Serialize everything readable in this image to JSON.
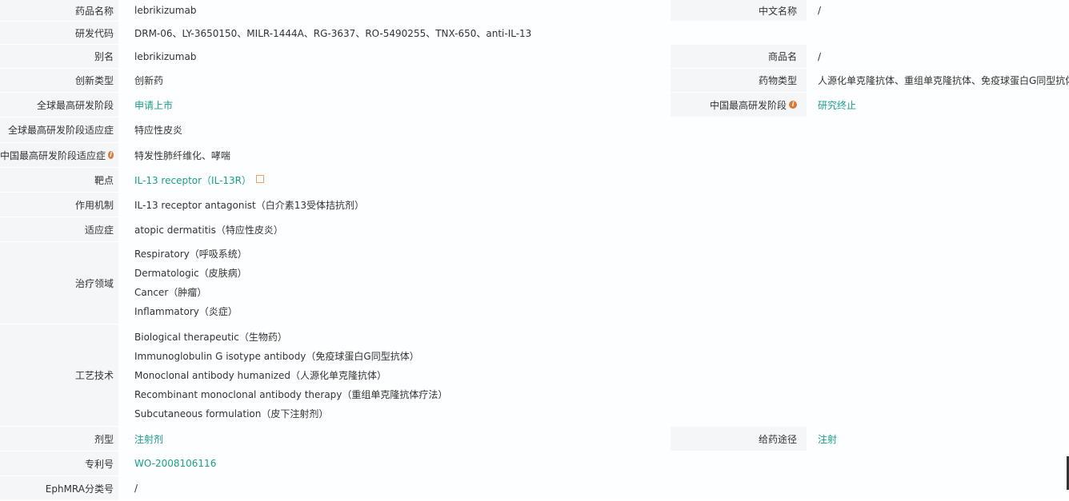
{
  "rows": {
    "drug_name": {
      "label": "药品名称",
      "value": "lebrikizumab",
      "label2": "中文名称",
      "value2": "/"
    },
    "rd_code": {
      "label": "研发代码",
      "value": "DRM-06、LY-3650150、MILR-1444A、RG-3637、RO-5490255、TNX-650、anti-IL-13"
    },
    "alias": {
      "label": "别名",
      "value": "lebrikizumab",
      "label2": "商品名",
      "value2": "/"
    },
    "innovation": {
      "label": "创新类型",
      "value": "创新药",
      "label2": "药物类型",
      "value2": "人源化单克隆抗体、重组单克隆抗体、免疫球蛋白G同型抗体"
    },
    "global_stage": {
      "label": "全球最高研发阶段",
      "value": "申请上市",
      "label2": "中国最高研发阶段",
      "value2": "研究终止"
    },
    "global_indication": {
      "label": "全球最高研发阶段适应症",
      "value": "特应性皮炎"
    },
    "china_indication": {
      "label": "中国最高研发阶段适应症",
      "value": "特发性肺纤维化、哮喘"
    },
    "target": {
      "label": "靶点",
      "value": "IL-13 receptor（IL-13R）"
    },
    "mechanism": {
      "label": "作用机制",
      "value": "IL-13 receptor antagonist（白介素13受体拮抗剂）"
    },
    "indication": {
      "label": "适应症",
      "value": "atopic dermatitis（特应性皮炎）"
    },
    "therapeutic_area": {
      "label": "治疗领域",
      "values": [
        "Respiratory（呼吸系统）",
        "Dermatologic（皮肤病）",
        "Cancer（肿瘤）",
        "Inflammatory（炎症）"
      ]
    },
    "technology": {
      "label": "工艺技术",
      "values": [
        "Biological therapeutic（生物药）",
        "Immunoglobulin G isotype antibody（免疫球蛋白G同型抗体）",
        "Monoclonal antibody humanized（人源化单克隆抗体）",
        "Recombinant monoclonal antibody therapy（重组单克隆抗体疗法）",
        "Subcutaneous formulation（皮下注射剂）"
      ]
    },
    "dosage_form": {
      "label": "剂型",
      "value": "注射剂",
      "label2": "给药途径",
      "value2": "注射"
    },
    "patent": {
      "label": "专利号",
      "value": "WO-2008106116"
    },
    "ephmra": {
      "label": "EphMRA分类号",
      "value": "/"
    }
  },
  "icons": {
    "info": "info-icon",
    "external": "external-link-icon"
  },
  "colors": {
    "link": "#1a9e8a",
    "label_bg": "#f4f6f8",
    "info_icon": "#d9793a"
  }
}
